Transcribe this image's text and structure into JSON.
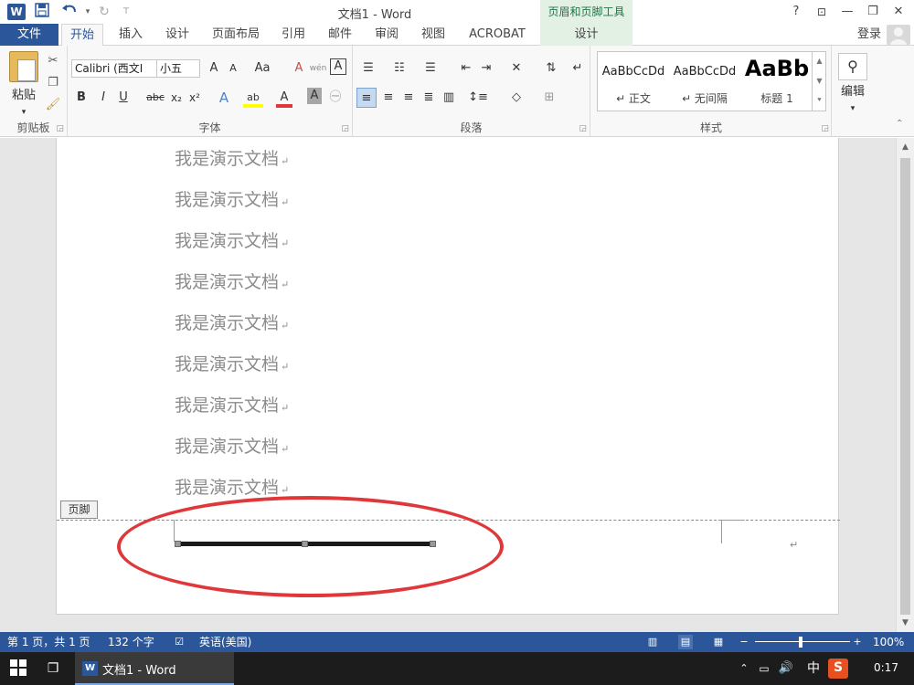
{
  "titlebar": {
    "app_logo": "W",
    "title": "文档1 - Word",
    "context_tab_header": "页眉和页脚工具",
    "help": "?",
    "ribbon_display": "⊡",
    "minimize": "—",
    "restore": "❐",
    "close": "✕",
    "quick_access": {
      "save_icon": "save-icon",
      "undo_icon": "undo-icon",
      "redo_icon": "redo-icon"
    }
  },
  "tabs": {
    "file": "文件",
    "items": [
      "开始",
      "插入",
      "设计",
      "页面布局",
      "引用",
      "邮件",
      "审阅",
      "视图",
      "ACROBAT"
    ],
    "active_index": 0,
    "context": "设计",
    "signin": "登录"
  },
  "ribbon": {
    "clipboard": {
      "paste": "粘贴",
      "label": "剪贴板"
    },
    "font": {
      "label": "字体",
      "font_name": "Calibri (西文I",
      "font_size": "小五",
      "grow": "A",
      "shrink": "A",
      "change_case": "Aa",
      "clear": "A",
      "phonetic": "wén",
      "border_char": "A",
      "bold": "B",
      "italic": "I",
      "underline": "U",
      "strike": "abc",
      "subscript": "x₂",
      "superscript": "x²",
      "effects": "A",
      "highlight": "ab",
      "font_color": "A",
      "shading": "A",
      "enclose": "㊀"
    },
    "paragraph": {
      "label": "段落"
    },
    "styles": {
      "label": "样式",
      "items": [
        {
          "sample": "AaBbCcDd",
          "name": "↵ 正文"
        },
        {
          "sample": "AaBbCcDd",
          "name": "↵ 无间隔"
        },
        {
          "sample": "AaBb",
          "name": "标题 1"
        }
      ]
    },
    "editing": {
      "label": "编辑"
    }
  },
  "document": {
    "lines": [
      "我是演示文档",
      "我是演示文档",
      "我是演示文档",
      "我是演示文档",
      "我是演示文档",
      "我是演示文档",
      "我是演示文档",
      "我是演示文档",
      "我是演示文档"
    ],
    "para_mark": "↵",
    "footer_tag": "页脚"
  },
  "statusbar": {
    "page": "第 1 页，共 1 页",
    "words": "132 个字",
    "language": "英语(美国)",
    "zoom": "100%"
  },
  "taskbar": {
    "app_label": "文档1 - Word",
    "app_logo": "W",
    "ime": "中",
    "clock": "0:17"
  },
  "colors": {
    "word_blue": "#2b579a",
    "context_green": "#e3f1e4",
    "highlight_red": "#e0383a"
  }
}
